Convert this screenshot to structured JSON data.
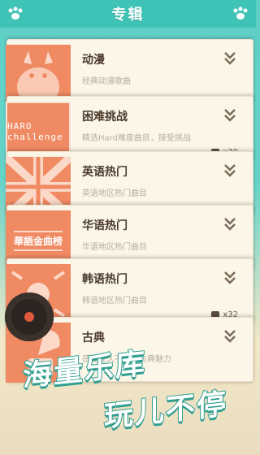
{
  "header": {
    "title": "专辑"
  },
  "albums": [
    {
      "name": "动漫",
      "desc": "经典动漫歌曲",
      "cover_text": "",
      "count": ""
    },
    {
      "name": "困难挑战",
      "desc": "精选Hard难度曲目，接受挑战",
      "cover_text": "HARO challenge",
      "count": "x30"
    },
    {
      "name": "英语热门",
      "desc": "英语地区热门曲目",
      "cover_text": "",
      "count": ""
    },
    {
      "name": "华语热门",
      "desc": "华语地区热门曲目",
      "cover_text": "華語金曲榜",
      "count": ""
    },
    {
      "name": "韩语热门",
      "desc": "韩语地区热门曲目",
      "cover_text": "",
      "count": "x32"
    },
    {
      "name": "古典",
      "desc": "感受经久不衰的古典魅力",
      "cover_text": "",
      "count": ""
    }
  ],
  "slogan": {
    "line1": "海量乐库",
    "line2": "玩儿不停"
  },
  "colors": {
    "accent": "#3fc3b6",
    "cover": "#f08a63",
    "card": "#fbf6e8"
  },
  "icons": {
    "paw": "paw-icon",
    "chevron": "double-chevron-down-icon"
  }
}
